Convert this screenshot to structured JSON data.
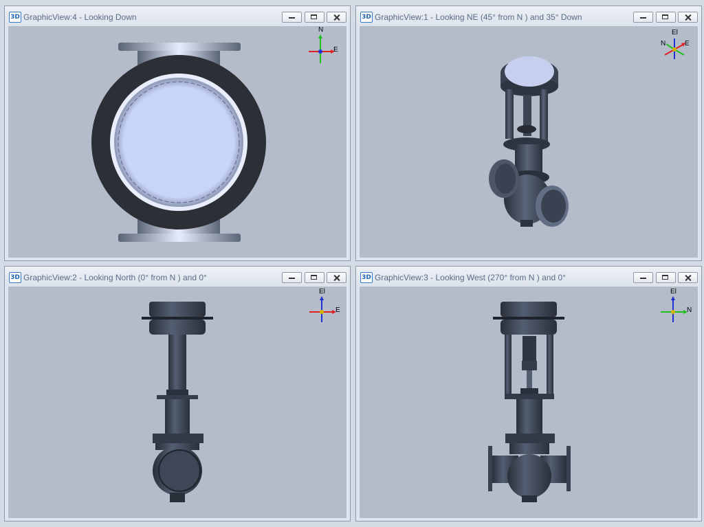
{
  "windows": [
    {
      "id": "view4",
      "title": "GraphicView:4 - Looking Down",
      "icon": "3D",
      "axes": {
        "up": "N",
        "right": "E"
      }
    },
    {
      "id": "view1",
      "title": "GraphicView:1 - Looking NE (45° from N ) and 35° Down",
      "icon": "3D",
      "axes": {
        "up": "El",
        "left": "N",
        "right": "E"
      }
    },
    {
      "id": "view2",
      "title": "GraphicView:2 - Looking North (0° from N ) and 0°",
      "icon": "3D",
      "axes": {
        "up": "El",
        "right": "E"
      }
    },
    {
      "id": "view3",
      "title": "GraphicView:3 - Looking West (270° from N ) and 0°",
      "icon": "3D",
      "axes": {
        "up": "El",
        "right": "N"
      }
    }
  ],
  "colors": {
    "viewport_bg": "#b4bcca",
    "axis_x": "#e02020",
    "axis_y": "#20c020",
    "axis_z": "#2030d0",
    "steel_dark": "#3a4352",
    "steel_light": "#c8d4f0"
  }
}
